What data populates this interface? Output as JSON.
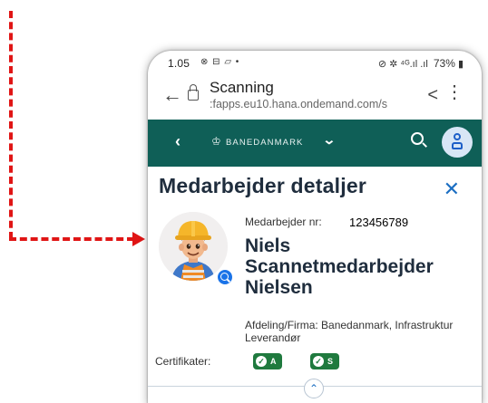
{
  "statusbar": {
    "time": "1.05",
    "icons_left": "⊗ ⊟ ▱ •",
    "icons_right": "⊘ ✲ ⁴ᴳ.ıl .ıl",
    "battery": "73%"
  },
  "browser": {
    "title": "Scanning",
    "url": ":fapps.eu10.hana.ondemand.com/s"
  },
  "appbar": {
    "brand": "BANEDANMARK",
    "brand_icon": "crown-icon"
  },
  "page": {
    "title": "Medarbejder detaljer",
    "close_symbol": "✕"
  },
  "employee": {
    "number_label": "Medarbejder nr:",
    "number": "123456789",
    "name": "Niels Scannetmedarbejder Nielsen",
    "department": "Afdeling/Firma: Banedanmark, Infrastruktur Leverandør"
  },
  "certificates": {
    "label": "Certifikater:",
    "items": [
      {
        "letter": "A",
        "color": "#1f7a3e"
      },
      {
        "letter": "S",
        "color": "#1f7a3e"
      }
    ]
  },
  "colors": {
    "appbar": "#0f5f57",
    "accent": "#1b6ec2",
    "annotation": "#e01515"
  }
}
